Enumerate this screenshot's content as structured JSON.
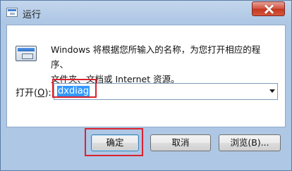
{
  "window": {
    "title": "运行"
  },
  "description": {
    "line1": "Windows 将根据您所输入的名称，为您打开相应的程序、",
    "line2": "文件夹、文档或 Internet 资源。"
  },
  "open_field": {
    "label_prefix": "打开(",
    "label_accel": "O",
    "label_suffix": "):",
    "value": "dxdiag"
  },
  "buttons": {
    "ok": "确定",
    "cancel": "取消",
    "browse": "浏览(B)..."
  },
  "icons": {
    "title": "run-dialog-icon",
    "app": "run-program-icon",
    "close": "close-icon",
    "dropdown": "chevron-down-icon"
  },
  "colors": {
    "title_bar": "#aec7e5",
    "close_button": "#c3371f",
    "selection": "#3399ff",
    "annotation": "#d8232f"
  }
}
